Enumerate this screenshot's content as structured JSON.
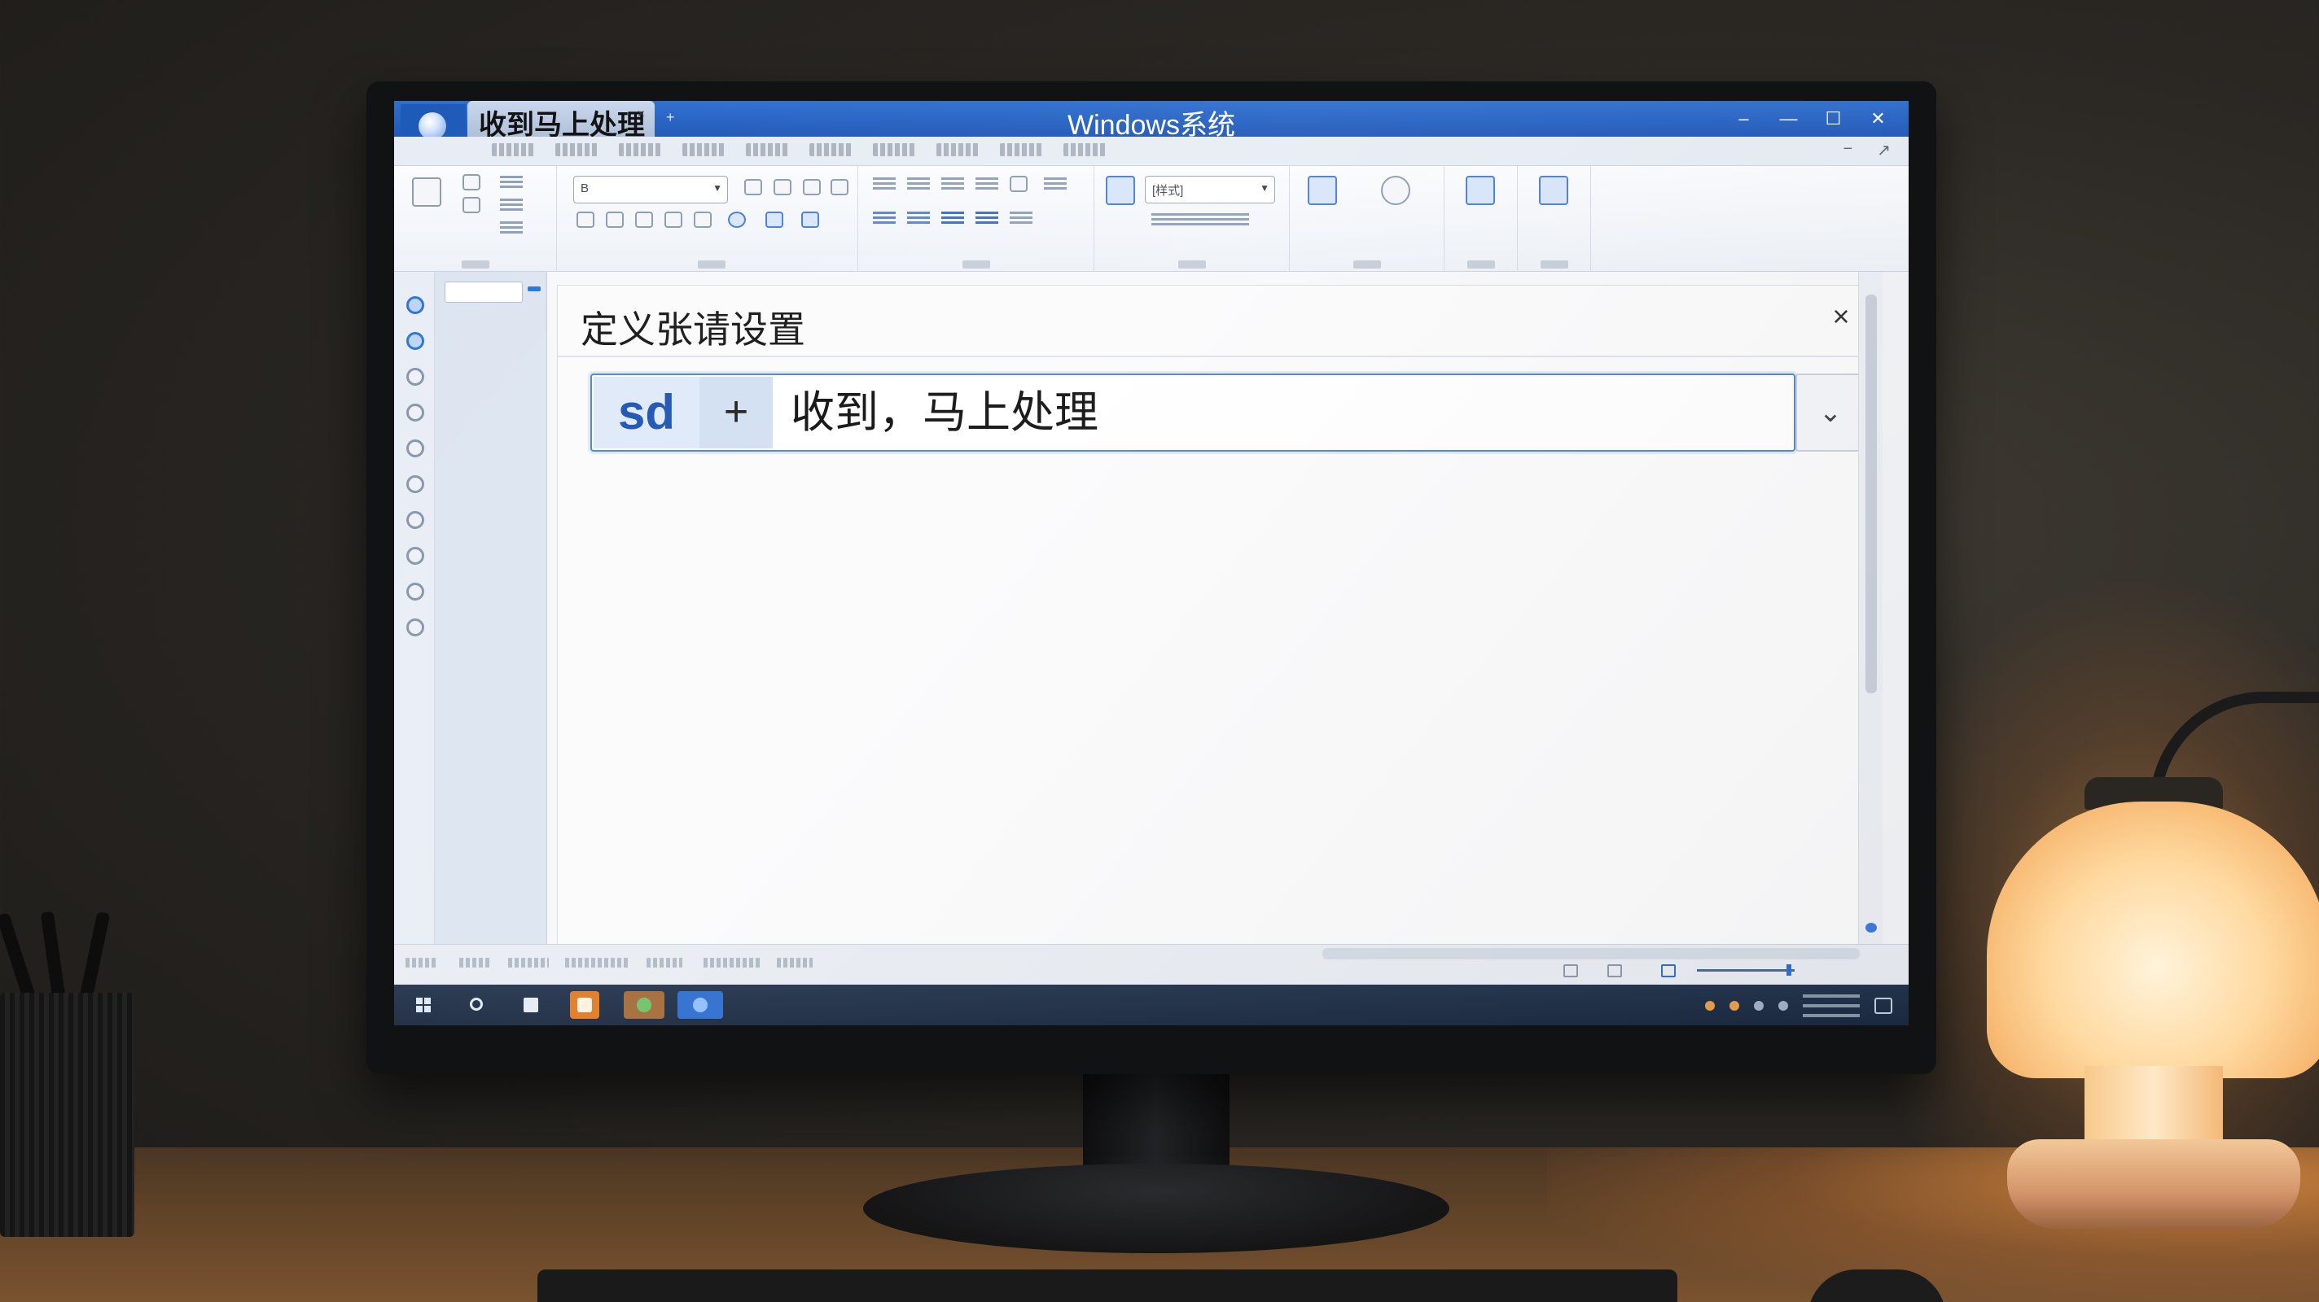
{
  "window": {
    "title": "Windows系统",
    "doc_tab": "收到马上处理",
    "doc_tab_close": "×",
    "new_tab": "+",
    "controls": {
      "help": "–",
      "minimize": "—",
      "maximize": "☐",
      "close": "✕"
    }
  },
  "dialog": {
    "title": "定义张请设置",
    "close": "×",
    "phrase": {
      "key": "sd",
      "joiner": "+",
      "text": "收到，马上处理",
      "dropdown": "⌄"
    }
  },
  "ribbon": {
    "font_box": "B",
    "style_box": "[样式]"
  },
  "icons": [
    "app-orb-icon",
    "windows-start-icon",
    "search-icon",
    "files-icon",
    "orange-app-icon",
    "green-app-icon",
    "blue-app-icon",
    "close-icon",
    "chevron-down-icon"
  ],
  "colors": {
    "title_bar": "#2f6fd0",
    "accent": "#4f86d9",
    "key_chip_text": "#1f56b4",
    "taskbar": "#1b2a40"
  }
}
